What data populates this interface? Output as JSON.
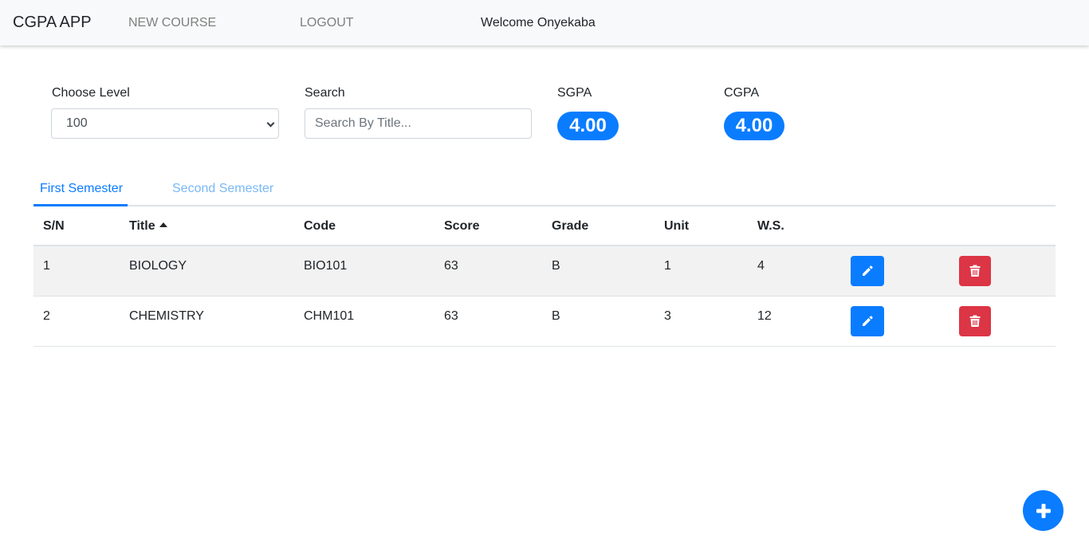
{
  "navbar": {
    "brand": "CGPA APP",
    "new_course": "NEW COURSE",
    "logout": "LOGOUT",
    "welcome": "Welcome Onyekaba"
  },
  "filters": {
    "level_label": "Choose Level",
    "level_value": "100",
    "search_label": "Search",
    "search_placeholder": "Search By Title..."
  },
  "gpa": {
    "sgpa_label": "SGPA",
    "sgpa_value": "4.00",
    "cgpa_label": "CGPA",
    "cgpa_value": "4.00"
  },
  "tabs": [
    {
      "label": "First Semester",
      "active": true
    },
    {
      "label": "Second Semester",
      "active": false
    }
  ],
  "table": {
    "headers": {
      "sn": "S/N",
      "title": "Title",
      "code": "Code",
      "score": "Score",
      "grade": "Grade",
      "unit": "Unit",
      "ws": "W.S."
    },
    "sort": {
      "column": "title",
      "direction": "ascending"
    },
    "rows": [
      {
        "sn": "1",
        "title": "BIOLOGY",
        "code": "BIO101",
        "score": "63",
        "grade": "B",
        "unit": "1",
        "ws": "4"
      },
      {
        "sn": "2",
        "title": "CHEMISTRY",
        "code": "CHM101",
        "score": "63",
        "grade": "B",
        "unit": "3",
        "ws": "12"
      }
    ]
  },
  "icons": {
    "edit": "pencil-icon",
    "delete": "trash-icon",
    "add": "plus-icon",
    "dropdown": "chevron-down-icon"
  },
  "colors": {
    "primary": "#0a7cff",
    "danger": "#dc3545",
    "tab_inactive": "#7ab8f5",
    "stripe": "#f2f2f2"
  }
}
